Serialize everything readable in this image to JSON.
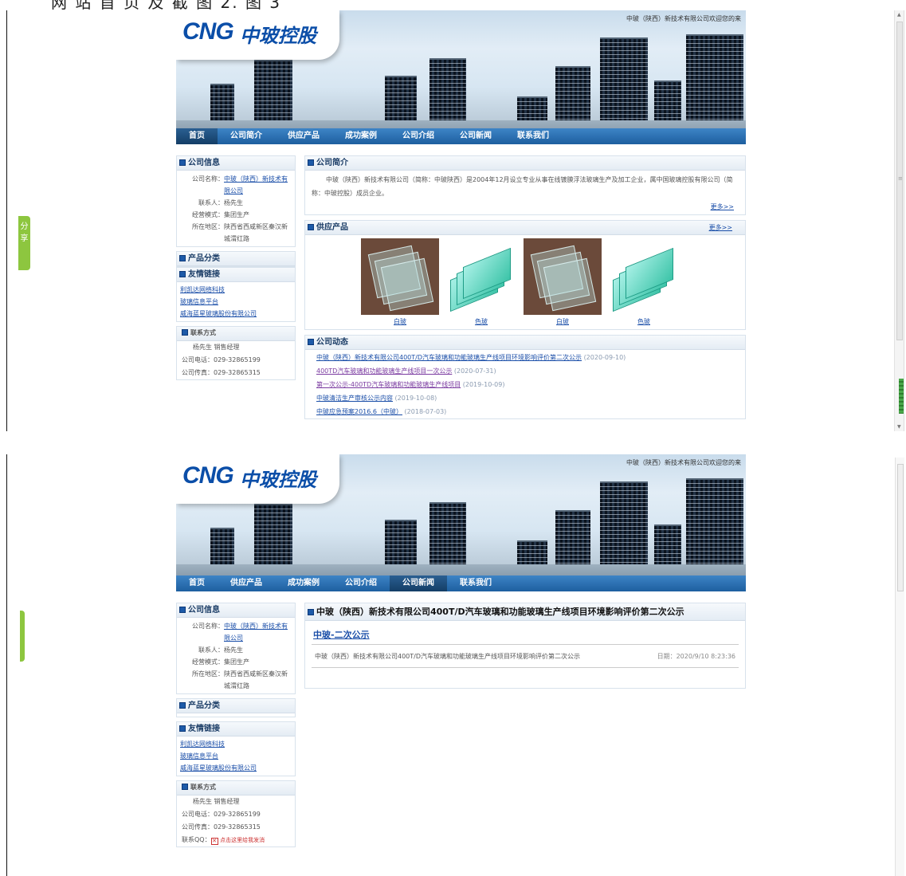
{
  "caption": "网 站 首 页 及 截 图 2.   图 3",
  "share_label": "分享",
  "brand": {
    "cng": "CNG",
    "cn": "中玻控股",
    "welcome": "中玻（陕西）新技术有限公司欢迎您的来"
  },
  "shot1": {
    "nav": [
      "首页",
      "公司简介",
      "供应产品",
      "成功案例",
      "公司介绍",
      "公司新闻",
      "联系我们"
    ],
    "info": {
      "title": "公司信息",
      "company_label": "公司名称：",
      "company_line1": "中玻（陕西）新技术有",
      "company_line2": "限公司",
      "contact_label": "联系人：",
      "contact": "杨先生",
      "mode_label": "经营模式：",
      "mode": "集团生产",
      "region_label": "所在地区：",
      "region_line1": "陕西省西咸新区秦汉新",
      "region_line2": "城渭红路"
    },
    "category_title": "产品分类",
    "links_title": "友情链接",
    "links": [
      "利凯达网络科技",
      "玻璃信息平台",
      "威海蓝星玻璃股份有限公司"
    ],
    "contact_box": {
      "title": "联系方式",
      "person": "杨先生  销售经理",
      "phone": "公司电话：029-32865199",
      "fax": "公司传真：029-32865315"
    },
    "intro": {
      "title": "公司简介",
      "text": "中玻（陕西）新技术有限公司（简称：中玻陕西）是2004年12月设立专业从事在线镀膜浮法玻璃生产及加工企业，属中国玻璃控股有限公司（简称：中玻控股）成员企业。",
      "more": "更多>>"
    },
    "products": {
      "title": "供应产品",
      "more": "更多>>",
      "items": [
        "白玻",
        "色玻",
        "白玻",
        "色玻"
      ]
    },
    "news": {
      "title": "公司动态",
      "items": [
        {
          "text": "中玻（陕西）新技术有限公司400T/D汽车玻璃和功能玻璃生产线项目环境影响评价第二次公示",
          "date": "(2020-09-10)"
        },
        {
          "text": "400TD汽车玻璃和功能玻璃生产线项目一次公示",
          "date": "(2020-07-31)"
        },
        {
          "text": "第一次公示-400TD汽车玻璃和功能玻璃生产线项目",
          "date": "(2019-10-09)"
        },
        {
          "text": "中玻清洁生产审核公示内容",
          "date": "(2019-10-08)"
        },
        {
          "text": "中玻应急预案2016.6（中玻）",
          "date": "(2018-07-03)"
        }
      ]
    }
  },
  "shot2": {
    "nav": [
      "首页",
      "供应产品",
      "成功案例",
      "公司介绍",
      "公司新闻",
      "联系我们"
    ],
    "info": {
      "title": "公司信息",
      "company_label": "公司名称：",
      "company_line1": "中玻（陕西）新技术有",
      "company_line2": "限公司",
      "contact_label": "联系人：",
      "contact": "杨先生",
      "mode_label": "经营模式：",
      "mode": "集团生产",
      "region_label": "所在地区：",
      "region_line1": "陕西省西咸新区秦汉新",
      "region_line2": "城渭红路"
    },
    "category_title": "产品分类",
    "links_title": "友情链接",
    "links": [
      "利凯达网络科技",
      "玻璃信息平台",
      "威海蓝星玻璃股份有限公司"
    ],
    "contact_box": {
      "title": "联系方式",
      "person": "杨先生  销售经理",
      "phone": "公司电话：029-32865199",
      "fax": "公司传真：029-32865315",
      "qq_label": "联系QQ：",
      "qq_alt": "点击这里给我发消"
    },
    "detail": {
      "title": "中玻（陕西）新技术有限公司400T/D汽车玻璃和功能玻璃生产线项目环境影响评价第二次公示",
      "sub": "中玻-二次公示",
      "row_text": "中玻（陕西）新技术有限公司400T/D汽车玻璃和功能玻璃生产线项目环境影响评价第二次公示",
      "row_date": "日期：2020/9/10 8:23:36"
    }
  }
}
